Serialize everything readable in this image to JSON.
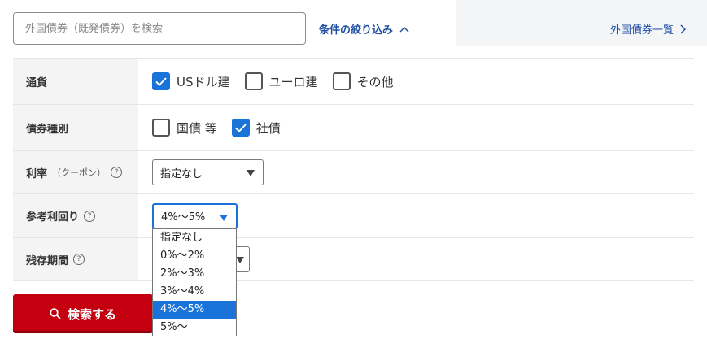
{
  "search": {
    "placeholder": "外国債券（既発債券）を検索"
  },
  "filter_toggle": {
    "label": "条件の絞り込み",
    "icon": "chevron-up-icon"
  },
  "list_link": {
    "label": "外国債券一覧",
    "icon": "chevron-right-icon"
  },
  "colors": {
    "accent": "#1a73d8",
    "link": "#1f4fa3",
    "button": "#c40010"
  },
  "filters": {
    "currency": {
      "label": "通貨",
      "options": [
        {
          "label": "USドル建",
          "checked": true
        },
        {
          "label": "ユーロ建",
          "checked": false
        },
        {
          "label": "その他",
          "checked": false
        }
      ]
    },
    "bond_type": {
      "label": "債券種別",
      "options": [
        {
          "label": "国債 等",
          "checked": false
        },
        {
          "label": "社債",
          "checked": true
        }
      ]
    },
    "coupon": {
      "label": "利率",
      "sub": "（クーポン）",
      "help": "?",
      "value": "指定なし"
    },
    "yield": {
      "label": "参考利回り",
      "help": "?",
      "value": "4%〜5%"
    },
    "remaining": {
      "label": "残存期間",
      "help": "?"
    }
  },
  "dropdown": {
    "options": [
      "指定なし",
      "0%〜2%",
      "2%〜3%",
      "3%〜4%",
      "4%〜5%",
      "5%〜"
    ],
    "selected": "4%〜5%"
  },
  "search_button": {
    "label": "検索する",
    "icon": "search-icon"
  }
}
